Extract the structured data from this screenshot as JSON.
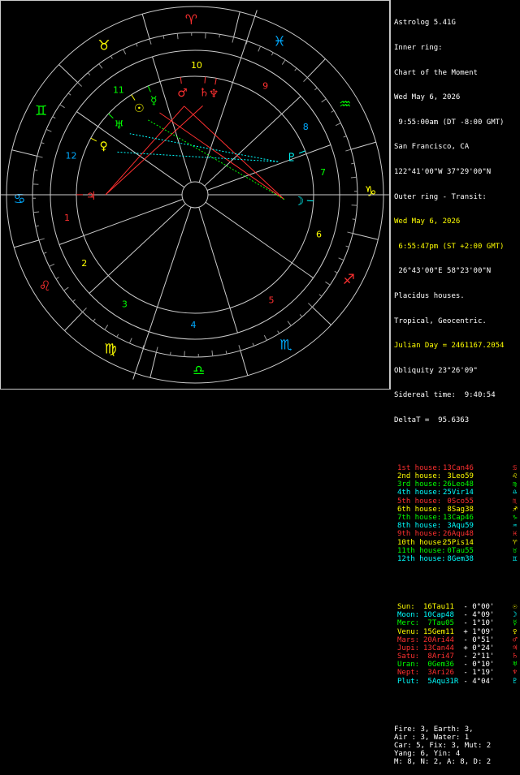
{
  "header": {
    "program": "Astrolog 5.41G",
    "inner_ring_label": "Inner ring:",
    "chart_name": "Chart of the Moment",
    "date": "Wed May 6, 2026",
    "time": " 9:55:00am (DT -8:00 GMT)",
    "place": "San Francisco, CA",
    "coords": "122°41'00\"W 37°29'00\"N",
    "outer_ring_label": "Outer ring - Transit:",
    "outer_date": "Wed May 6, 2026",
    "outer_time": " 6:55:47pm (ST +2:00 GMT)",
    "outer_coords": " 26°43'00\"E 58°23'00\"N",
    "house_system": "Placidus houses.",
    "zodiac": "Tropical, Geocentric.",
    "julian_day": "Julian Day = 2461167.2054",
    "obliquity": "Obliquity 23°26'09\"",
    "sidereal_time": "Sidereal time:  9:40:54",
    "delta_t": "DeltaT =  95.6363"
  },
  "houses": [
    {
      "label": "1st house:",
      "value": "13Can46",
      "color": "#ff3030",
      "symbol": "♋"
    },
    {
      "label": "2nd house:",
      "value": " 3Leo59",
      "color": "#ffff00",
      "symbol": "♌"
    },
    {
      "label": "3rd house:",
      "value": "26Leo48",
      "color": "#00ff00",
      "symbol": "♍"
    },
    {
      "label": "4th house:",
      "value": "25Vir14",
      "color": "#00ffff",
      "symbol": "♎"
    },
    {
      "label": "5th house:",
      "value": " 0Sco55",
      "color": "#ff3030",
      "symbol": "♏"
    },
    {
      "label": "6th house:",
      "value": " 8Sag38",
      "color": "#ffff00",
      "symbol": "♐"
    },
    {
      "label": "7th house:",
      "value": "13Cap46",
      "color": "#00ff00",
      "symbol": "♑"
    },
    {
      "label": "8th house:",
      "value": " 3Aqu59",
      "color": "#00ffff",
      "symbol": "♒"
    },
    {
      "label": "9th house:",
      "value": "26Aqu48",
      "color": "#ff3030",
      "symbol": "♓"
    },
    {
      "label": "10th house:",
      "value": "25Pis14",
      "color": "#ffff00",
      "symbol": "♈"
    },
    {
      "label": "11th house:",
      "value": " 0Tau55",
      "color": "#00ff00",
      "symbol": "♉"
    },
    {
      "label": "12th house:",
      "value": " 8Gem38",
      "color": "#00ffff",
      "symbol": "♊"
    }
  ],
  "planets": [
    {
      "name": "Sun:",
      "value": "16Tau11",
      "extra": " - 0°00'",
      "color": "#ffff00",
      "symbol": "☉"
    },
    {
      "name": "Moon:",
      "value": "10Cap48",
      "extra": " - 4°09'",
      "color": "#00ffff",
      "symbol": "☽"
    },
    {
      "name": "Merc:",
      "value": " 7Tau05",
      "extra": " - 1°10'",
      "color": "#00ff00",
      "symbol": "☿"
    },
    {
      "name": "Venu:",
      "value": "15Gem11",
      "extra": " + 1°09'",
      "color": "#ffff00",
      "symbol": "♀"
    },
    {
      "name": "Mars:",
      "value": "20Ari44",
      "extra": " - 0°51'",
      "color": "#ff3030",
      "symbol": "♂"
    },
    {
      "name": "Jupi:",
      "value": "13Can44",
      "extra": " + 0°24'",
      "color": "#ff3030",
      "symbol": "♃"
    },
    {
      "name": "Satu:",
      "value": " 8Ari47",
      "extra": " - 2°11'",
      "color": "#ff3030",
      "symbol": "♄"
    },
    {
      "name": "Uran:",
      "value": " 0Gem36",
      "extra": " - 0°10'",
      "color": "#00ff00",
      "symbol": "♅"
    },
    {
      "name": "Nept:",
      "value": " 3Ari26",
      "extra": " - 1°19'",
      "color": "#ff3030",
      "symbol": "♆"
    },
    {
      "name": "Plut:",
      "value": " 5Aqu31R",
      "extra": " - 4°04'",
      "color": "#00ffff",
      "symbol": "♇"
    }
  ],
  "summary": [
    "Fire: 3, Earth: 3,",
    "Air : 3, Water: 1",
    "Car: 5, Fix: 3, Mut: 2",
    "Yang: 6, Yin: 4",
    "M: 8, N: 2, A: 8, D: 2"
  ],
  "wheel": {
    "sign_glyphs": [
      {
        "glyph": "♈",
        "color": "#ff3030",
        "name": "aries"
      },
      {
        "glyph": "♉",
        "color": "#ffff00",
        "name": "taurus"
      },
      {
        "glyph": "♊",
        "color": "#00ff00",
        "name": "gemini"
      },
      {
        "glyph": "♋",
        "color": "#00aaff",
        "name": "cancer"
      },
      {
        "glyph": "♌",
        "color": "#ff3030",
        "name": "leo"
      },
      {
        "glyph": "♍",
        "color": "#ffff00",
        "name": "virgo"
      },
      {
        "glyph": "♎",
        "color": "#00ff00",
        "name": "libra"
      },
      {
        "glyph": "♏",
        "color": "#00aaff",
        "name": "scorpio"
      },
      {
        "glyph": "♐",
        "color": "#ff3030",
        "name": "sagittarius"
      },
      {
        "glyph": "♑",
        "color": "#ffff00",
        "name": "capricorn"
      },
      {
        "glyph": "♒",
        "color": "#00ff00",
        "name": "aquarius"
      },
      {
        "glyph": "♓",
        "color": "#00aaff",
        "name": "pisces"
      }
    ],
    "house_numbers": [
      {
        "n": "1",
        "color": "#ff3030"
      },
      {
        "n": "2",
        "color": "#ffff00"
      },
      {
        "n": "3",
        "color": "#00ff00"
      },
      {
        "n": "4",
        "color": "#00aaff"
      },
      {
        "n": "5",
        "color": "#ff3030"
      },
      {
        "n": "6",
        "color": "#ffff00"
      },
      {
        "n": "7",
        "color": "#00ff00"
      },
      {
        "n": "8",
        "color": "#00aaff"
      },
      {
        "n": "9",
        "color": "#ff3030"
      },
      {
        "n": "10",
        "color": "#ffff00"
      },
      {
        "n": "11",
        "color": "#00ff00"
      },
      {
        "n": "12",
        "color": "#00aaff"
      }
    ]
  }
}
